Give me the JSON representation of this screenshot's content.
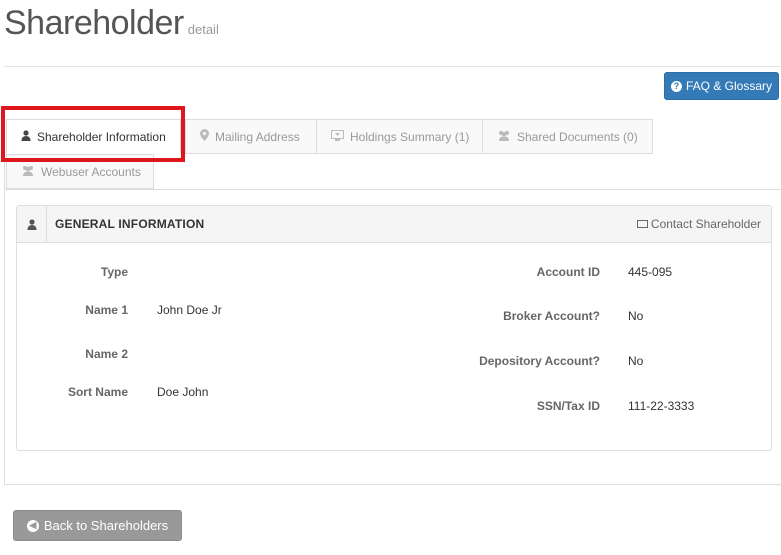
{
  "header": {
    "title": "Shareholder",
    "subtitle": "detail"
  },
  "faq_button": {
    "label": "FAQ & Glossary",
    "icon": "question-circle-icon"
  },
  "tabs": [
    {
      "label": "Shareholder Information",
      "icon": "user-icon",
      "active": true
    },
    {
      "label": "Mailing Address",
      "icon": "map-marker-icon",
      "active": false
    },
    {
      "label": "Holdings Summary (1)",
      "icon": "holdings-icon",
      "active": false
    },
    {
      "label": "Shared Documents (0)",
      "icon": "users-icon",
      "active": false
    },
    {
      "label": "Webuser Accounts",
      "icon": "users-icon",
      "active": false
    }
  ],
  "panel": {
    "title": "GENERAL INFORMATION",
    "contact_label": "Contact Shareholder",
    "left_fields": [
      {
        "label": "Type",
        "value": ""
      },
      {
        "label": "Name 1",
        "value": "John Doe Jr"
      },
      {
        "label": "Name 2",
        "value": ""
      },
      {
        "label": "Sort Name",
        "value": "Doe John"
      }
    ],
    "right_fields": [
      {
        "label": "Account ID",
        "value": "445-095"
      },
      {
        "label": "Broker Account?",
        "value": "No"
      },
      {
        "label": "Depository Account?",
        "value": "No"
      },
      {
        "label": "SSN/Tax ID",
        "value": "111-22-3333"
      }
    ]
  },
  "back_button": {
    "label": "Back to Shareholders"
  },
  "colors": {
    "primary": "#337ab7",
    "highlight": "#e0161f",
    "secondary_button": "#999999"
  }
}
